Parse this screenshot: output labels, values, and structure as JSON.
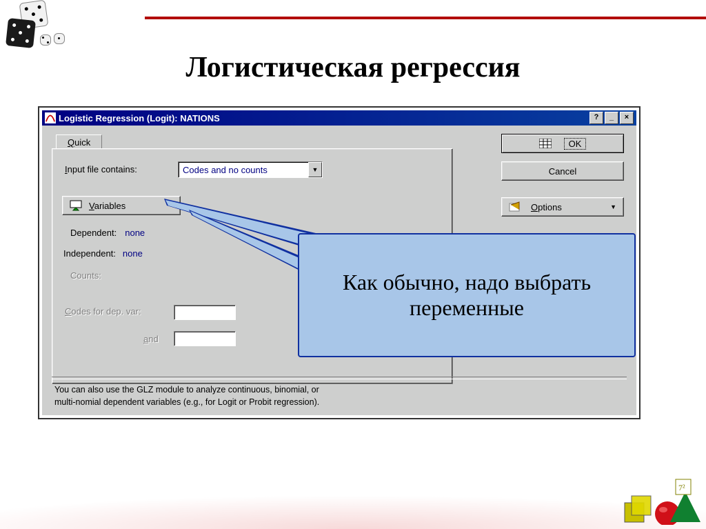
{
  "slide": {
    "title": "Логистическая регрессия"
  },
  "dialog": {
    "title": "Logistic Regression (Logit): NATIONS",
    "tab": {
      "label_pre": "",
      "label_ul": "Q",
      "label_post": "uick"
    },
    "input_file_label": {
      "pre": "",
      "ul": "I",
      "post": "nput file contains:"
    },
    "input_file_value": "Codes and no counts",
    "variables_btn": {
      "ul": "V",
      "post": "ariables"
    },
    "dependent_label": "Dependent:",
    "dependent_value": "none",
    "independent_label": "Independent:",
    "independent_value": "none",
    "counts_label": "Counts:",
    "codes_label": {
      "ul": "C",
      "post": "odes for dep. var:"
    },
    "and_label": {
      "ul": "a",
      "post": "nd"
    },
    "ok_label": "OK",
    "cancel_label": "Cancel",
    "options_label": {
      "ul": "O",
      "post": "ptions"
    },
    "hint_line1": "You can also use the GLZ module to analyze continuous, binomial, or",
    "hint_line2": "multi-nomial dependent variables (e.g., for Logit or Probit regression)."
  },
  "callout": {
    "text": "Как обычно, надо выбрать переменные"
  }
}
